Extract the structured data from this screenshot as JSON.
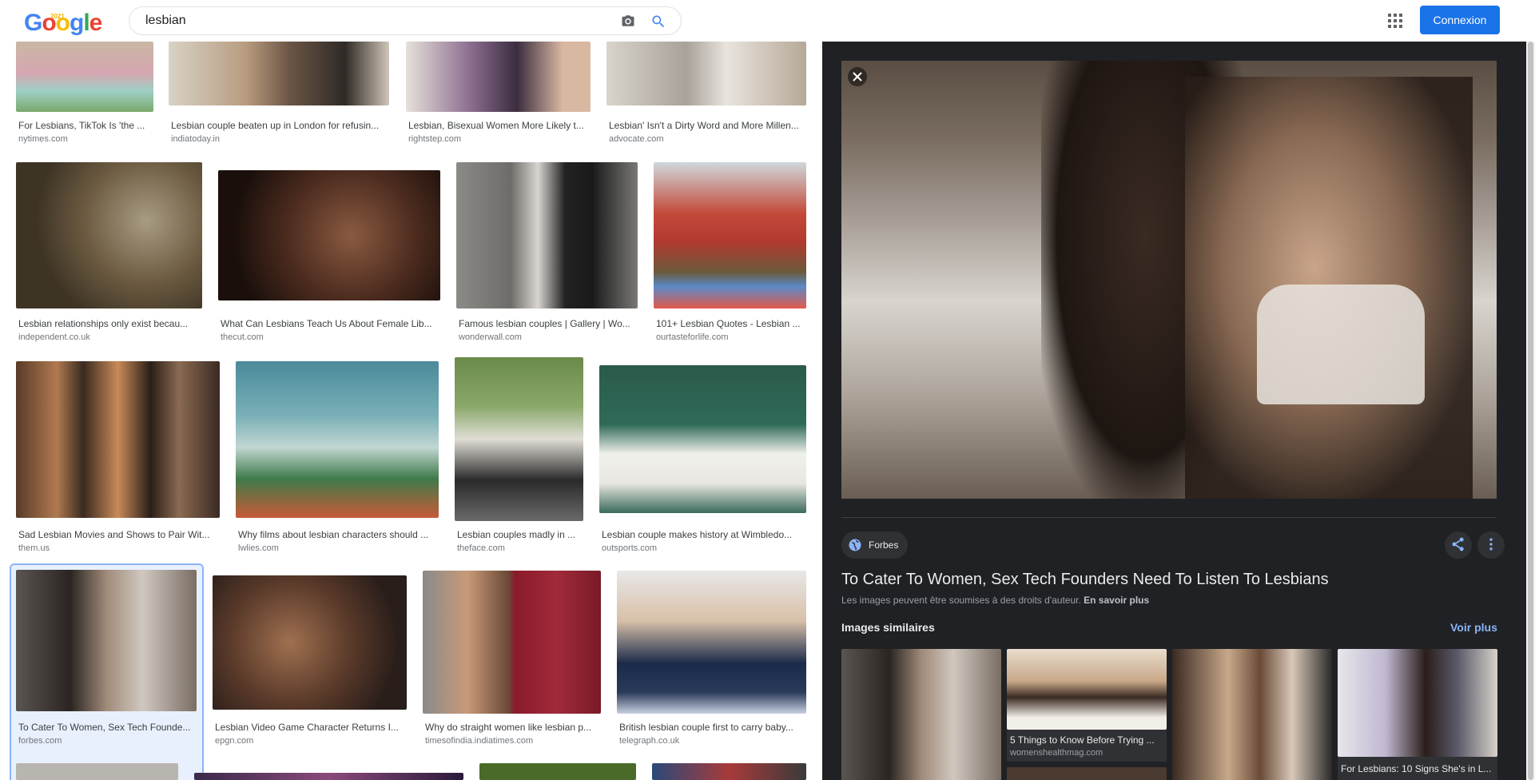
{
  "header": {
    "logo_letters": [
      "G",
      "o",
      "o",
      "g",
      "l",
      "e"
    ],
    "logo_colors": [
      "#4285f4",
      "#ea4335",
      "#fbbc05",
      "#4285f4",
      "#34a853",
      "#ea4335"
    ],
    "doodle_year": "2021",
    "search_value": "lesbian",
    "camera_icon": "camera-icon",
    "search_icon": "search-icon",
    "apps_icon": "apps-grid-icon",
    "signin_label": "Connexion"
  },
  "results": [
    {
      "title": "For Lesbians, TikTok Is 'the ...",
      "source": "nytimes.com"
    },
    {
      "title": "Lesbian couple beaten up in London for refusin...",
      "source": "indiatoday.in"
    },
    {
      "title": "Lesbian, Bisexual Women More Likely t...",
      "source": "rightstep.com"
    },
    {
      "title": "Lesbian' Isn't a Dirty Word and More Millen...",
      "source": "advocate.com"
    },
    {
      "title": "Lesbian relationships only exist becau...",
      "source": "independent.co.uk"
    },
    {
      "title": "What Can Lesbians Teach Us About Female Lib...",
      "source": "thecut.com"
    },
    {
      "title": "Famous lesbian couples | Gallery | Wo...",
      "source": "wonderwall.com"
    },
    {
      "title": "101+ Lesbian Quotes - Lesbian ...",
      "source": "ourtasteforlife.com"
    },
    {
      "title": "Sad Lesbian Movies and Shows to Pair Wit...",
      "source": "them.us"
    },
    {
      "title": "Why films about lesbian characters should ...",
      "source": "lwlies.com"
    },
    {
      "title": "Lesbian couples madly in ...",
      "source": "theface.com"
    },
    {
      "title": "Lesbian couple makes history at Wimbledo...",
      "source": "outsports.com"
    },
    {
      "title": "To Cater To Women, Sex Tech Founde...",
      "source": "forbes.com"
    },
    {
      "title": "Lesbian Video Game Character Returns I...",
      "source": "epgn.com"
    },
    {
      "title": "Why do straight women like lesbian p...",
      "source": "timesofindia.indiatimes.com"
    },
    {
      "title": "British lesbian couple first to carry baby...",
      "source": "telegraph.co.uk"
    }
  ],
  "panel": {
    "close_icon": "close-icon",
    "source_chip": "Forbes",
    "globe_icon": "globe-icon",
    "share_icon": "share-icon",
    "more_icon": "more-vert-icon",
    "title": "To Cater To Women, Sex Tech Founders Need To Listen To Lesbians",
    "copyright": "Les images peuvent être soumises à des droits d'auteur.",
    "learn_more": "En savoir plus",
    "similar_heading": "Images similaires",
    "see_more": "Voir plus",
    "similar": [
      {
        "caption": "",
        "source": ""
      },
      {
        "caption": "5 Things to Know Before Trying ...",
        "source": "womenshealthmag.com"
      },
      {
        "caption": "",
        "source": ""
      },
      {
        "caption": "For Lesbians: 10 Signs She's in L...",
        "source": ""
      }
    ]
  },
  "colors": {
    "accent": "#1a73e8",
    "panel_bg": "#202124",
    "link": "#8ab4f8"
  }
}
